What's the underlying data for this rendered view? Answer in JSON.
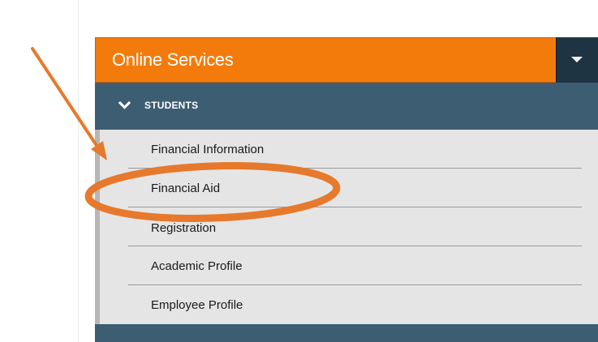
{
  "menu": {
    "title": "Online Services",
    "toggle_icon": "caret-down-icon",
    "section": {
      "label": "STUDENTS",
      "icon": "chevron-down-icon"
    },
    "items": [
      {
        "label": "Financial Information"
      },
      {
        "label": "Financial Aid"
      },
      {
        "label": "Registration"
      },
      {
        "label": "Academic Profile"
      },
      {
        "label": "Employee Profile"
      }
    ]
  },
  "annotation": {
    "color": "#e6792c",
    "shapes": [
      "arrow",
      "ellipse-highlight"
    ],
    "highlighted_item": "Financial Aid"
  },
  "colors": {
    "header_orange": "#f37b0c",
    "header_toggle": "#1f3443",
    "section_blue": "#3d5d73",
    "list_background": "#e5e5e5"
  }
}
